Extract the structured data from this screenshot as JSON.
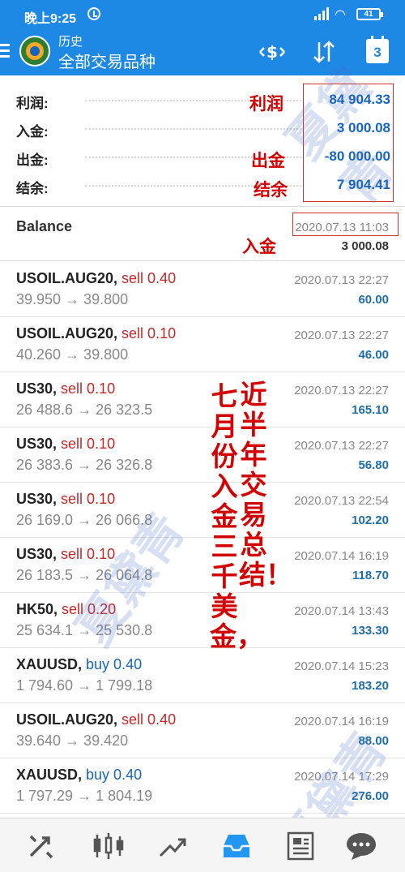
{
  "status_bar": {
    "time": "晚上9:25",
    "network": "4G",
    "battery": "41"
  },
  "app_bar": {
    "subtitle": "历史",
    "title": "全部交易品种",
    "calendar_day": "3"
  },
  "summary": [
    {
      "label": "利润:",
      "value": "84 904.33"
    },
    {
      "label": "入金:",
      "value": "3 000.08"
    },
    {
      "label": "出金:",
      "value": "-80 000.00"
    },
    {
      "label": "结余:",
      "value": "7 904.41"
    }
  ],
  "annotations": {
    "profit": "利润",
    "withdraw": "出金",
    "balance": "结余",
    "deposit": "入金"
  },
  "balance_row": {
    "name": "Balance",
    "date": "2020.07.13 11:03",
    "amount": "3 000.08"
  },
  "deals": [
    {
      "symbol": "USOIL.AUG20,",
      "side": "sell 0.40",
      "side_type": "sell",
      "prices": "39.950 → 39.800",
      "date": "2020.07.13 22:27",
      "profit": "60.00"
    },
    {
      "symbol": "USOIL.AUG20,",
      "side": "sell 0.10",
      "side_type": "sell",
      "prices": "40.260 → 39.800",
      "date": "2020.07.13 22:27",
      "profit": "46.00"
    },
    {
      "symbol": "US30,",
      "side": "sell 0.10",
      "side_type": "sell",
      "prices": "26 488.6 → 26 323.5",
      "date": "2020.07.13 22:27",
      "profit": "165.10"
    },
    {
      "symbol": "US30,",
      "side": "sell 0.10",
      "side_type": "sell",
      "prices": "26 383.6 → 26 326.8",
      "date": "2020.07.13 22:27",
      "profit": "56.80"
    },
    {
      "symbol": "US30,",
      "side": "sell 0.10",
      "side_type": "sell",
      "prices": "26 169.0 → 26 066.8",
      "date": "2020.07.13 22:54",
      "profit": "102.20"
    },
    {
      "symbol": "US30,",
      "side": "sell 0.10",
      "side_type": "sell",
      "prices": "26 183.5 → 26 064.8",
      "date": "2020.07.14 16:19",
      "profit": "118.70"
    },
    {
      "symbol": "HK50,",
      "side": "sell 0.20",
      "side_type": "sell",
      "prices": "25 634.1 → 25 530.8",
      "date": "2020.07.14 13:43",
      "profit": "133.30"
    },
    {
      "symbol": "XAUUSD,",
      "side": "buy 0.40",
      "side_type": "buy",
      "prices": "1 794.60 → 1 799.18",
      "date": "2020.07.14 15:23",
      "profit": "183.20"
    },
    {
      "symbol": "USOIL.AUG20,",
      "side": "sell 0.40",
      "side_type": "sell",
      "prices": "39.640 → 39.420",
      "date": "2020.07.14 16:19",
      "profit": "88.00"
    },
    {
      "symbol": "XAUUSD,",
      "side": "buy 0.40",
      "side_type": "buy",
      "prices": "1 797.29 → 1 804.19",
      "date": "2020.07.14 17:29",
      "profit": "276.00"
    }
  ],
  "handwritten": {
    "right_column": "近半年交易总结！",
    "left_column": "七月份入金三千美金，"
  },
  "watermark": "夏黛青",
  "colors": {
    "header": "#1e88e5",
    "sell": "#c62828",
    "buy": "#1565c0",
    "profit": "#1e6fa8",
    "annotation": "#d40000"
  },
  "bottom_nav": [
    "trade-icon",
    "chart-icon",
    "analytics-icon",
    "history-icon",
    "news-icon",
    "chat-icon"
  ]
}
